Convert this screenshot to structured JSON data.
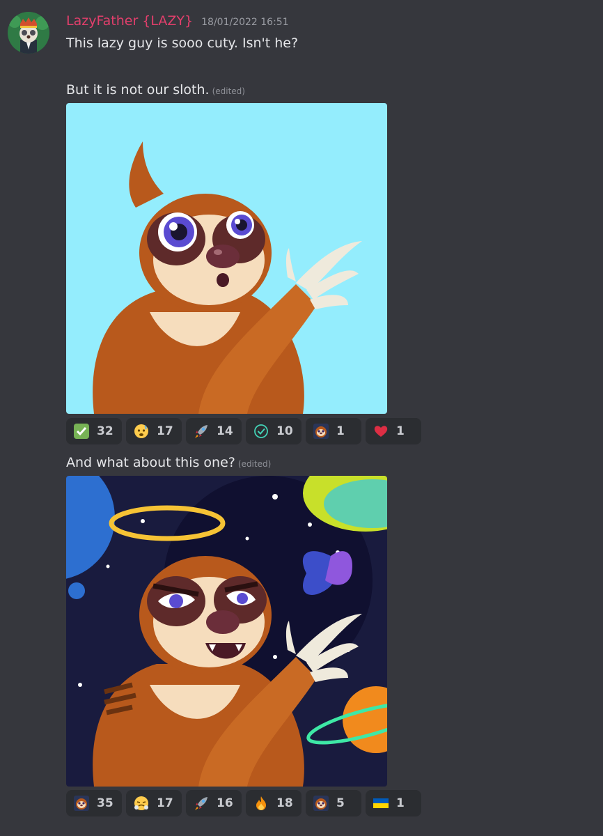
{
  "message": {
    "username": "LazyFather {LAZY}",
    "timestamp": "18/01/2022 16:51",
    "colors": {
      "background": "#36373d",
      "username": "#e23f6c",
      "reaction_bg": "#2b2d31"
    },
    "lines": {
      "line1": "This lazy guy is sooo cuty. Isn't he?",
      "line2": "But it is not our sloth.",
      "line3": "And what about this one?"
    },
    "edited_label": "(edited)"
  },
  "images": [
    {
      "name": "sloth-cyan-background",
      "background": "#94edfd"
    },
    {
      "name": "sloth-space-background",
      "background": "#191b3e"
    }
  ],
  "reactions_1": [
    {
      "icon": "check-mark-icon",
      "count": "32"
    },
    {
      "icon": "anxious-face-icon",
      "count": "17"
    },
    {
      "icon": "rocket-icon",
      "count": "14"
    },
    {
      "icon": "check-circle-icon",
      "count": "10"
    },
    {
      "icon": "sloth-avatar-icon",
      "count": "1"
    },
    {
      "icon": "heart-icon",
      "count": "1"
    }
  ],
  "reactions_2": [
    {
      "icon": "sloth-avatar-icon",
      "count": "35"
    },
    {
      "icon": "steam-nose-face-icon",
      "count": "17"
    },
    {
      "icon": "rocket-icon",
      "count": "16"
    },
    {
      "icon": "fire-icon",
      "count": "18"
    },
    {
      "icon": "sloth-avatar-icon",
      "count": "5"
    },
    {
      "icon": "ukraine-flag-icon",
      "count": "1"
    }
  ]
}
